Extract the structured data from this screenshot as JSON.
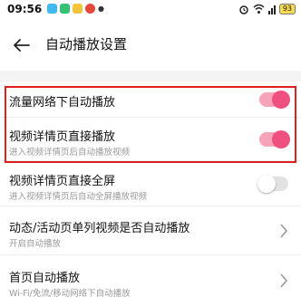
{
  "status_bar": {
    "time": "09:56",
    "battery": "93",
    "app_colors": [
      "#41b8f1",
      "#36c274",
      "#f2c43c",
      "#e8473b"
    ]
  },
  "header": {
    "title": "自动播放设置"
  },
  "settings": {
    "items": [
      {
        "title": "流量网络下自动播放",
        "subtitle": "",
        "control": "toggle",
        "on": true
      },
      {
        "title": "视频详情页直接播放",
        "subtitle": "进入视频详情页后自动播放视频",
        "control": "toggle",
        "on": true
      },
      {
        "title": "视频详情页直接全屏",
        "subtitle": "进入视频详情页后自动全屏播放视频",
        "control": "toggle",
        "on": false
      },
      {
        "title": "动态/活动页单列视频是否自动播放",
        "subtitle": "开启自动播放",
        "control": "chevron"
      },
      {
        "title": "首页自动播放",
        "subtitle": "Wi-Fi/免流/移动网络下自动播放",
        "control": "chevron"
      }
    ]
  },
  "colors": {
    "accent": "#f0507f",
    "accent_track": "#f7a3ba",
    "highlight": "#e02020"
  }
}
